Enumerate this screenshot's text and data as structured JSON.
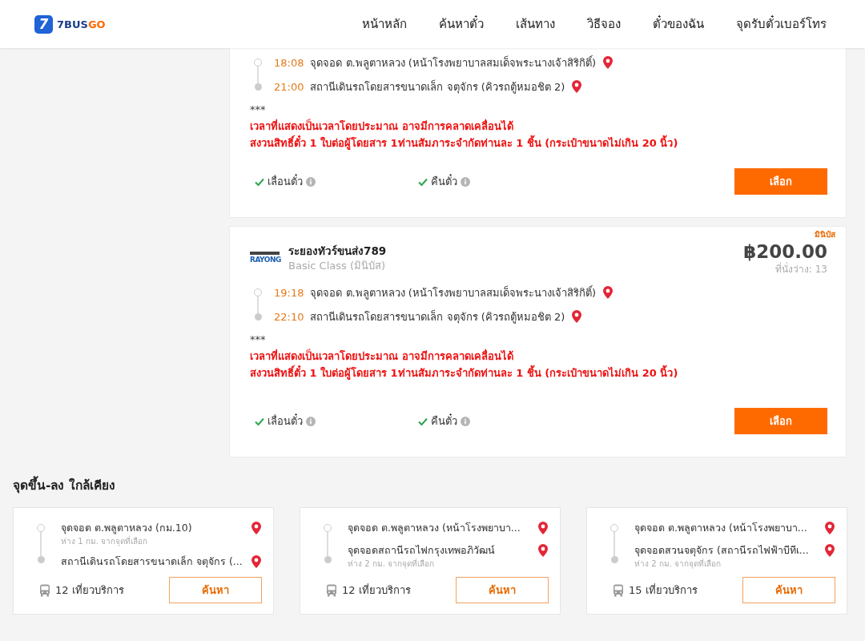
{
  "header": {
    "logo_mark": "7",
    "logo_text": "7BUS",
    "logo_accent": "GO",
    "nav": [
      {
        "label": "หน้าหลัก"
      },
      {
        "label": "ค้นหาตั๋ว"
      },
      {
        "label": "เส้นทาง"
      },
      {
        "label": "วิธีจอง"
      },
      {
        "label": "ตั๋วของฉัน"
      },
      {
        "label": "จุดรับตั๋วเบอร์โทร"
      }
    ]
  },
  "trips": [
    {
      "stops": [
        {
          "time": "18:08",
          "name": "จุดจอด ต.พลูตาหลวง (หน้าโรงพยาบาลสมเด็จพระนางเจ้าสิริกิติ์)"
        },
        {
          "time": "21:00",
          "name": "สถานีเดินรถโดยสารขนาดเล็ก จตุจักร (คิวรถตู้หมอชิต 2)"
        }
      ],
      "notes": [
        "***",
        "เวลาที่แสดงเป็นเวลาโดยประมาณ อาจมีการคลาดเคลื่อนได้",
        "สงวนสิทธิ์ตั๋ว 1 ใบต่อผู้โดยสาร 1ท่านสัมภาระจำกัดท่านละ 1 ชิ้น (กระเป๋าขนาดไม่เกิน 20 นิ้ว)"
      ],
      "features": [
        {
          "label": "เลื่อนตั๋ว",
          "available": true
        },
        {
          "label": "คืนตั๋ว",
          "available": true
        }
      ],
      "button": "เลือก"
    },
    {
      "badge": "มินิบัส",
      "operator_logo": "RAYONG",
      "operator": "ระยองทัวร์ขนส่ง789",
      "class": "Basic Class (มินิบัส)",
      "price": "฿200.00",
      "seats": "ที่นั่งว่าง: 13",
      "stops": [
        {
          "time": "19:18",
          "name": "จุดจอด ต.พลูตาหลวง (หน้าโรงพยาบาลสมเด็จพระนางเจ้าสิริกิติ์)"
        },
        {
          "time": "22:10",
          "name": "สถานีเดินรถโดยสารขนาดเล็ก จตุจักร (คิวรถตู้หมอชิต 2)"
        }
      ],
      "notes": [
        "***",
        "เวลาที่แสดงเป็นเวลาโดยประมาณ อาจมีการคลาดเคลื่อนได้",
        "สงวนสิทธิ์ตั๋ว 1 ใบต่อผู้โดยสาร 1ท่านสัมภาระจำกัดท่านละ 1 ชิ้น (กระเป๋าขนาดไม่เกิน 20 นิ้ว)"
      ],
      "features": [
        {
          "label": "เลื่อนตั๋ว",
          "available": true
        },
        {
          "label": "คืนตั๋ว",
          "available": true
        }
      ],
      "button": "เลือก"
    }
  ],
  "nearby": {
    "title": "จุดขึ้น-ลง ใกล้เคียง",
    "cards": [
      {
        "stops": [
          {
            "name": "จุดจอด ต.พลูตาหลวง (กม.10)",
            "distance": "ห่าง 1 กม. จากจุดที่เลือก"
          },
          {
            "name": "สถานีเดินรถโดยสารขนาดเล็ก จตุจักร (..."
          }
        ],
        "trips": "12 เที่ยวบริการ",
        "button": "ค้นหา"
      },
      {
        "stops": [
          {
            "name": "จุดจอด ต.พลูตาหลวง (หน้าโรงพยาบา..."
          },
          {
            "name": "จุดจอดสถานีรถไฟกรุงเทพอภิวัฒน์",
            "distance": "ห่าง 2 กม. จากจุดที่เลือก"
          }
        ],
        "trips": "12 เที่ยวบริการ",
        "button": "ค้นหา"
      },
      {
        "stops": [
          {
            "name": "จุดจอด ต.พลูตาหลวง (หน้าโรงพยาบา..."
          },
          {
            "name": "จุดจอดสวนจตุจักร (สถานีรถไฟฟ้าบีทีเ...",
            "distance": "ห่าง 2 กม. จากจุดที่เลือก"
          }
        ],
        "trips": "15 เที่ยวบริการ",
        "button": "ค้นหา"
      }
    ]
  }
}
